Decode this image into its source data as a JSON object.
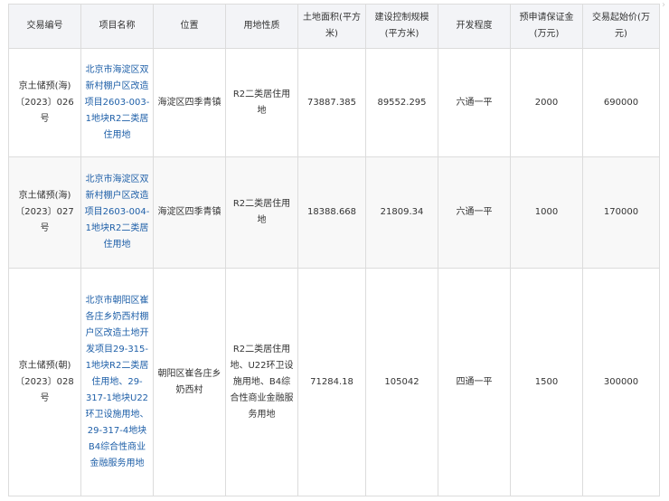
{
  "table": {
    "headers": [
      "交易编号",
      "项目名称",
      "位置",
      "用地性质",
      "土地面积(平方米)",
      "建设控制规模(平方米)",
      "开发程度",
      "预申请保证金(万元)",
      "交易起始价(万元)"
    ],
    "rows": [
      {
        "id": "京土储预(海)〔2023〕026号",
        "project": "北京市海淀区双新村棚户区改造项目2603-003-1地块R2二类居住用地",
        "location": "海淀区四季青镇",
        "land_use": "R2二类居住用地",
        "area": "73887.385",
        "build_scale": "89552.295",
        "development": "六通一平",
        "deposit": "2000",
        "start_price": "690000"
      },
      {
        "id": "京土储预(海)〔2023〕027号",
        "project": "北京市海淀区双新村棚户区改造项目2603-004-1地块R2二类居住用地",
        "location": "海淀区四季青镇",
        "land_use": "R2二类居住用地",
        "area": "18388.668",
        "build_scale": "21809.34",
        "development": "六通一平",
        "deposit": "1000",
        "start_price": "170000"
      },
      {
        "id": "京土储预(朝)〔2023〕028号",
        "project": "北京市朝阳区崔各庄乡奶西村棚户区改造土地开发项目29-315-1地块R2二类居住用地、29-317-1地块U22环卫设施用地、29-317-4地块B4综合性商业金融服务用地",
        "location": "朝阳区崔各庄乡奶西村",
        "land_use": "R2二类居住用地、U22环卫设施用地、B4综合性商业金融服务用地",
        "area": "71284.18",
        "build_scale": "105042",
        "development": "四通一平",
        "deposit": "1500",
        "start_price": "300000"
      }
    ]
  }
}
